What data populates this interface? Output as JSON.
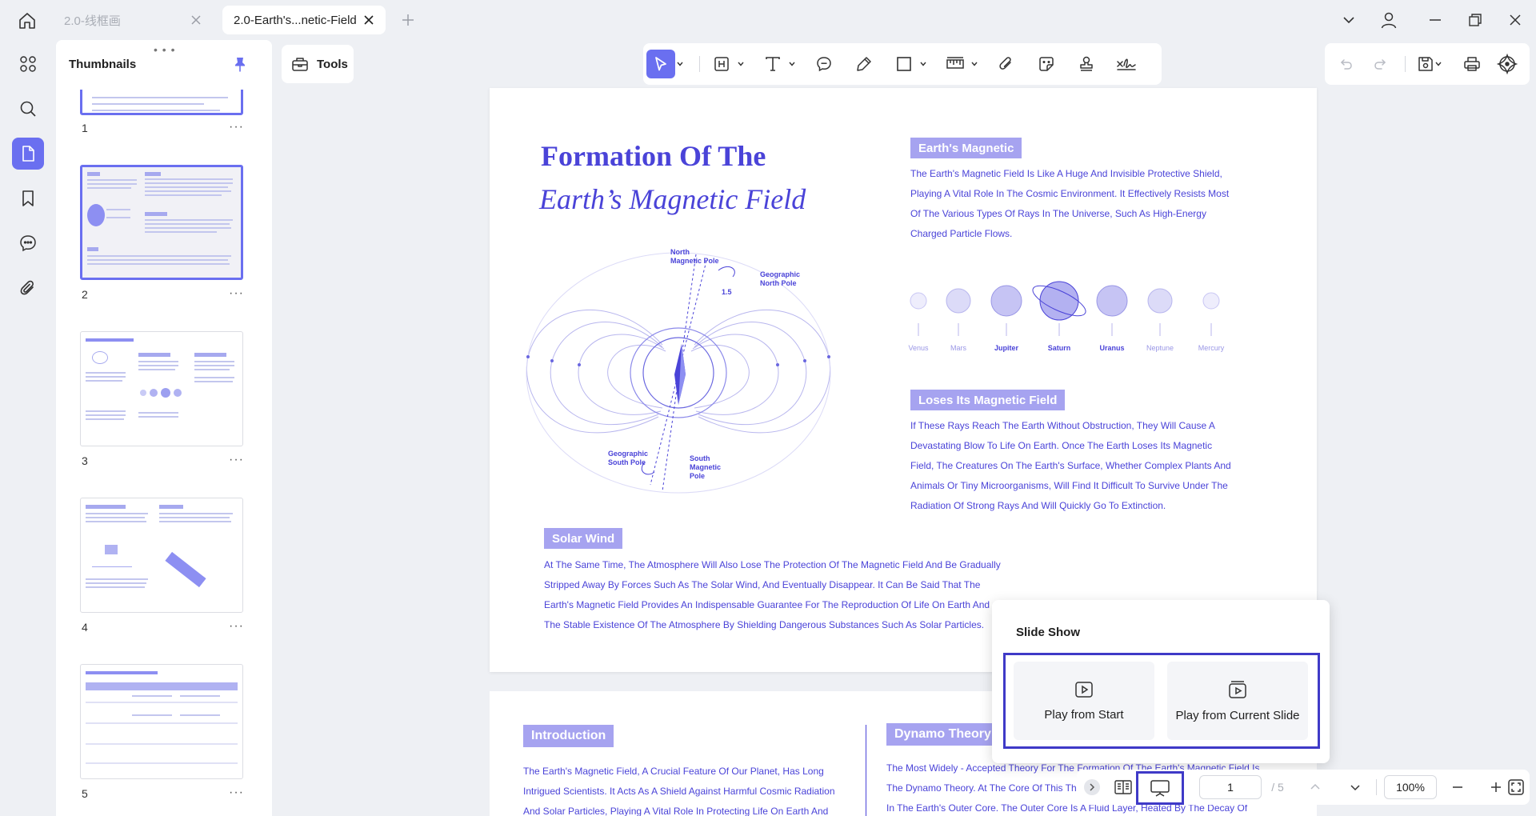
{
  "tabs": [
    {
      "label": "2.0-线框画",
      "active": false
    },
    {
      "label": "2.0-Earth's...netic-Field",
      "active": true
    }
  ],
  "sidebar": {
    "title": "Thumbnails",
    "pages": [
      "1",
      "2",
      "3",
      "4",
      "5"
    ],
    "selected_page": "2",
    "more_glyph": "···"
  },
  "toolbar": {
    "tools_label": "Tools"
  },
  "document": {
    "title_line1": "Formation Of The",
    "title_line2": "Earth’s Magnetic Field",
    "diagram_labels": {
      "north_magnetic": "North\nMagnetic Pole",
      "geo_north": "Geographic\nNorth Pole",
      "angle": "1.5",
      "geo_south": "Geographic\nSouth Pole",
      "south_magnetic": "South\nMagnetic\nPole"
    },
    "earths_magnetic": {
      "heading": "Earth's Magnetic",
      "lines": [
        "The Earth's Magnetic Field Is Like A Huge And Invisible Protective Shield,",
        "Playing A Vital Role In The Cosmic Environment. It Effectively Resists Most",
        "Of The Various Types Of Rays In The Universe, Such As High-Energy",
        "Charged Particle Flows."
      ]
    },
    "planets": [
      "Venus",
      "Mars",
      "Jupiter",
      "Saturn",
      "Uranus",
      "Neptune",
      "Mercury"
    ],
    "loses_field": {
      "heading": "Loses Its Magnetic Field",
      "lines": [
        "If These Rays Reach The Earth Without Obstruction, They Will Cause A",
        "Devastating Blow To Life On Earth. Once The Earth Loses Its Magnetic",
        "Field, The Creatures On The Earth's Surface, Whether Complex Plants And",
        "Animals Or Tiny Microorganisms, Will Find It Difficult To Survive Under The",
        "Radiation Of Strong Rays And Will Quickly Go To Extinction."
      ]
    },
    "solar_wind": {
      "heading": "Solar Wind",
      "lines": [
        "At The Same Time, The Atmosphere Will Also Lose The Protection Of The Magnetic Field And Be Gradually",
        "Stripped Away By Forces Such As The Solar Wind, And Eventually Disappear. It Can Be Said That The",
        "Earth's Magnetic Field Provides An Indispensable Guarantee For The Reproduction Of Life On Earth And",
        "The Stable Existence Of The Atmosphere By Shielding Dangerous Substances Such As Solar Particles."
      ]
    },
    "introduction": {
      "heading": "Introduction",
      "lines": [
        "The Earth's Magnetic Field, A Crucial Feature Of Our Planet, Has Long",
        "Intrigued Scientists. It Acts As A Shield Against Harmful Cosmic Radiation",
        "And Solar Particles, Playing A Vital Role In Protecting Life On Earth And"
      ]
    },
    "dynamo": {
      "heading": "Dynamo Theory",
      "lines": [
        "The Most Widely - Accepted Theory For The Formation Of The Earth's Magnetic Field Is",
        "The Dynamo Theory. At The Core Of This Theory Is",
        "In The Earth's Outer Core. The Outer Core Is A Fluid Layer, Heated By The Decay Of"
      ]
    }
  },
  "slideshow": {
    "title": "Slide Show",
    "play_from_start": "Play from Start",
    "play_from_current": "Play from Current Slide"
  },
  "statusbar": {
    "current_page": "1",
    "total_pages": "/ 5",
    "zoom": "100%"
  },
  "colors": {
    "accent": "#6a6ff0",
    "doc_blue": "#4a43d8",
    "highlight_border": "#3f3ac7"
  }
}
